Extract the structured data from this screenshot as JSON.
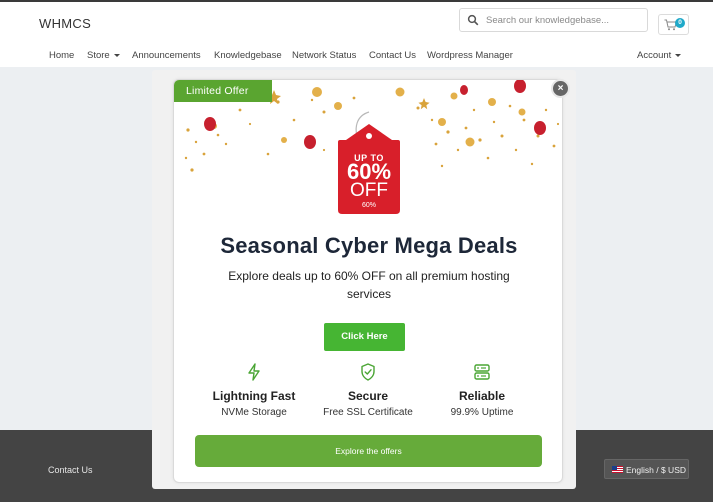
{
  "header": {
    "brand": "WHMCS",
    "search_placeholder": "Search our knowledgebase...",
    "cart_count": "0"
  },
  "nav": {
    "items": [
      "Home",
      "Store",
      "Announcements",
      "Knowledgebase",
      "Network Status",
      "Contact Us",
      "Wordpress Manager"
    ],
    "account": "Account"
  },
  "popup": {
    "ribbon": "Limited Offer",
    "tag": {
      "line1": "UP TO",
      "line2": "60%",
      "line3": "OFF",
      "line4": "60%"
    },
    "headline": "Seasonal Cyber Mega Deals",
    "subtext": "Explore deals up to 60% OFF on all premium hosting services",
    "cta": "Click Here",
    "features": [
      {
        "icon": "lightning-icon",
        "title": "Lightning Fast",
        "desc": "NVMe Storage"
      },
      {
        "icon": "shield-check-icon",
        "title": "Secure",
        "desc": "Free SSL Certificate"
      },
      {
        "icon": "server-icon",
        "title": "Reliable",
        "desc": "99.9% Uptime"
      }
    ],
    "explore": "Explore the offers",
    "close": "×"
  },
  "footer": {
    "contact": "Contact Us",
    "language": "English / $ USD"
  },
  "colors": {
    "accent_green": "#46b533",
    "ribbon_green": "#5aa530",
    "tag_red": "#d81f2a",
    "headline": "#1d2738",
    "footer_bg": "#444444",
    "cart_badge": "#1fa9c9"
  }
}
